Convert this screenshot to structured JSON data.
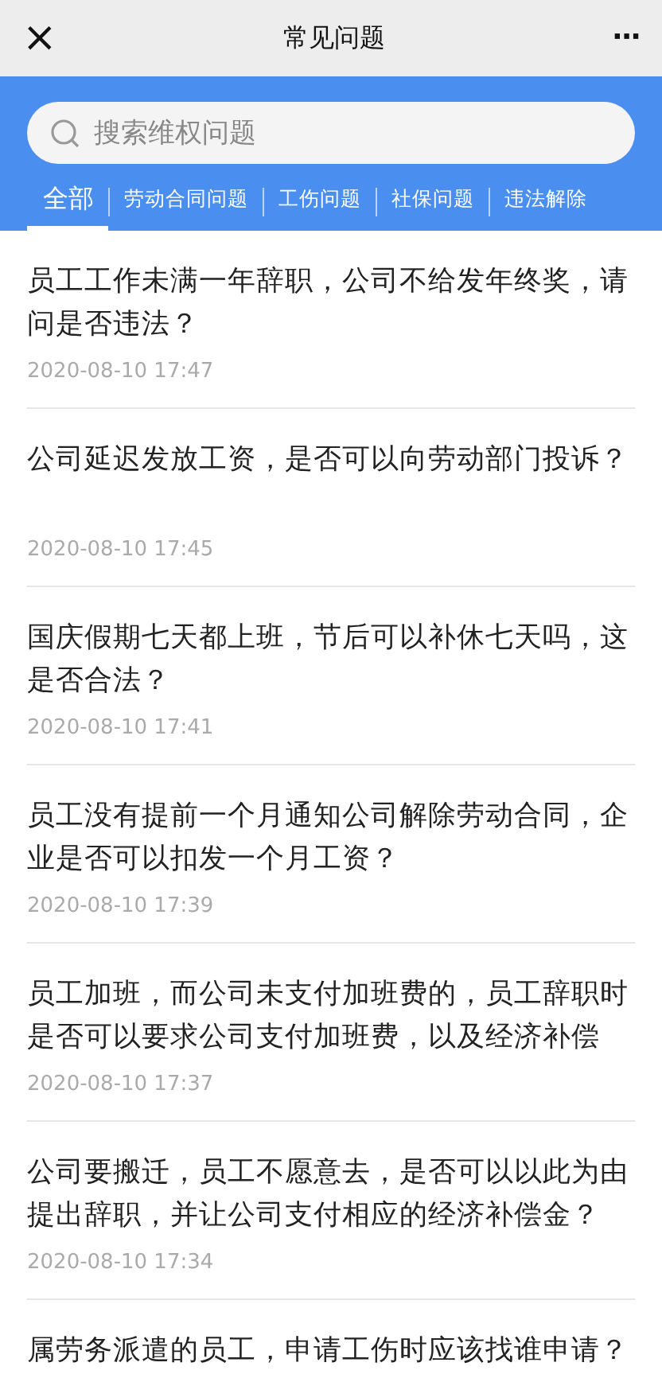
{
  "window": {
    "title": "常见问题",
    "close": "×",
    "more": "···"
  },
  "search": {
    "placeholder": "搜索维权问题"
  },
  "tabs": [
    {
      "label": "全部",
      "selected": true
    },
    {
      "label": "劳动合同问题",
      "selected": false
    },
    {
      "label": "工伤问题",
      "selected": false
    },
    {
      "label": "社保问题",
      "selected": false
    },
    {
      "label": "违法解除",
      "selected": false
    }
  ],
  "questions": [
    {
      "title": "员工工作未满一年辞职，公司不给发年终奖，请问是否违法？",
      "time": "2020-08-10 17:47"
    },
    {
      "title": "公司延迟发放工资，是否可以向劳动部门投诉？",
      "time": "2020-08-10 17:45"
    },
    {
      "title": "国庆假期七天都上班，节后可以补休七天吗，这是否合法？",
      "time": "2020-08-10 17:41"
    },
    {
      "title": "员工没有提前一个月通知公司解除劳动合同，企业是否可以扣发一个月工资？",
      "time": "2020-08-10 17:39"
    },
    {
      "title": "员工加班，而公司未支付加班费的，员工辞职时是否可以要求公司支付加班费，以及经济补偿",
      "time": "2020-08-10 17:37"
    },
    {
      "title": "公司要搬迁，员工不愿意去，是否可以以此为由提出辞职，并让公司支付相应的经济补偿金？",
      "time": "2020-08-10 17:34"
    },
    {
      "title": "属劳务派遣的员工，申请工伤时应该找谁申请？"
    }
  ]
}
